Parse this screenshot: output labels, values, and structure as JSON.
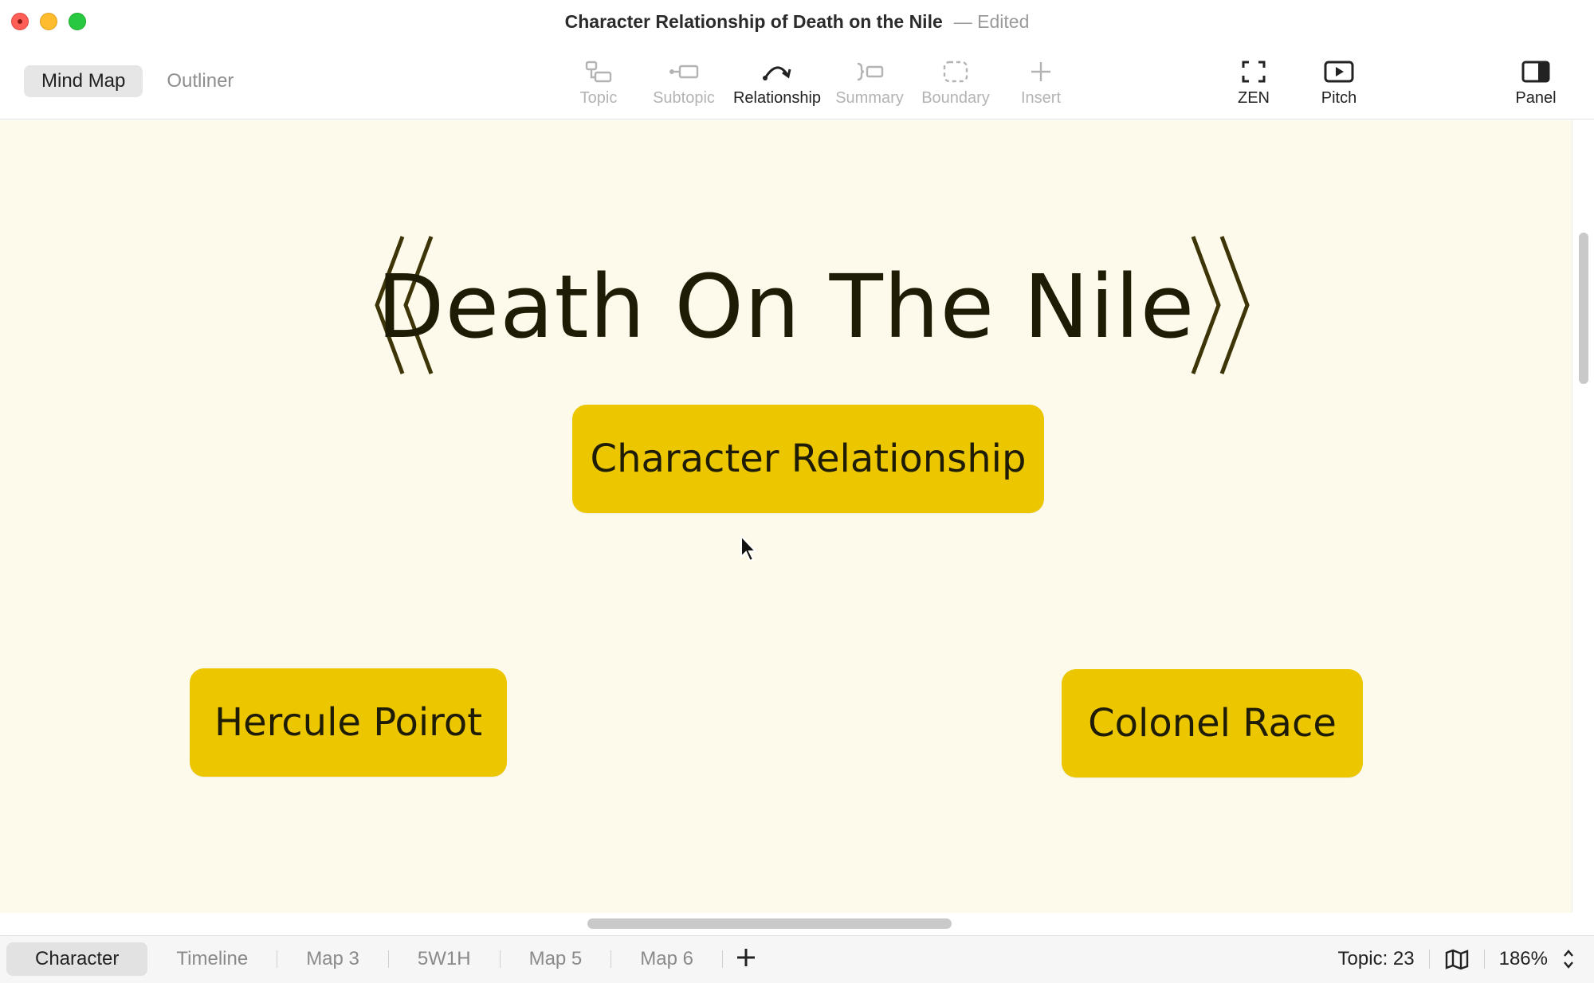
{
  "window": {
    "title": "Character Relationship of Death on the Nile",
    "state": "— Edited"
  },
  "view_switch": {
    "mind_map": "Mind Map",
    "outliner": "Outliner",
    "active": "Mind Map"
  },
  "toolbar": {
    "topic": "Topic",
    "subtopic": "Subtopic",
    "relationship": "Relationship",
    "summary": "Summary",
    "boundary": "Boundary",
    "insert": "Insert",
    "zen": "ZEN",
    "pitch": "Pitch",
    "panel": "Panel"
  },
  "canvas": {
    "title": "Death On The Nile",
    "central_topic": "Character Relationship",
    "topics": [
      "Hercule Poirot",
      "Colonel Race"
    ],
    "background": "#fdfaeb",
    "topic_color": "#ecc700"
  },
  "sheets": {
    "tabs": [
      "Character",
      "Timeline",
      "Map 3",
      "5W1H",
      "Map 5",
      "Map 6"
    ],
    "active": "Character"
  },
  "status": {
    "topic_count": "Topic: 23",
    "zoom": "186%"
  }
}
